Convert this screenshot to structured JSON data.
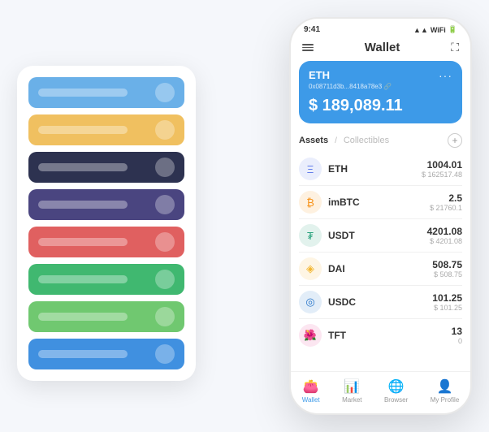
{
  "scene": {
    "background_color": "#f5f7fb"
  },
  "card_stack": {
    "cards": [
      {
        "color": "#6ab0e8",
        "label": ""
      },
      {
        "color": "#f0c060",
        "label": ""
      },
      {
        "color": "#2d3250",
        "label": ""
      },
      {
        "color": "#4a4580",
        "label": ""
      },
      {
        "color": "#e06060",
        "label": ""
      },
      {
        "color": "#40b870",
        "label": ""
      },
      {
        "color": "#70c870",
        "label": ""
      },
      {
        "color": "#4090e0",
        "label": ""
      }
    ]
  },
  "phone": {
    "status_bar": {
      "time": "9:41",
      "icons": "▲▲ ◀"
    },
    "header": {
      "title": "Wallet",
      "menu_icon": "☰",
      "expand_icon": "⛶"
    },
    "eth_card": {
      "title": "ETH",
      "address": "0x08711d3b...8418a78e3 🔗",
      "balance": "$ 189,089.11",
      "menu": "..."
    },
    "tabs": {
      "active": "Assets",
      "slash": "/",
      "inactive": "Collectibles"
    },
    "assets": [
      {
        "name": "ETH",
        "amount": "1004.01",
        "usd": "$ 162517.48",
        "icon_color": "#627eea",
        "icon_symbol": "Ξ"
      },
      {
        "name": "imBTC",
        "amount": "2.5",
        "usd": "$ 21760.1",
        "icon_color": "#f7931a",
        "icon_symbol": "₿"
      },
      {
        "name": "USDT",
        "amount": "4201.08",
        "usd": "$ 4201.08",
        "icon_color": "#26a17b",
        "icon_symbol": "₮"
      },
      {
        "name": "DAI",
        "amount": "508.75",
        "usd": "$ 508.75",
        "icon_color": "#f4b731",
        "icon_symbol": "◈"
      },
      {
        "name": "USDC",
        "amount": "101.25",
        "usd": "$ 101.25",
        "icon_color": "#2775ca",
        "icon_symbol": "◎"
      },
      {
        "name": "TFT",
        "amount": "13",
        "usd": "0",
        "icon_color": "#e84393",
        "icon_symbol": "🌺"
      }
    ],
    "bottom_nav": [
      {
        "label": "Wallet",
        "icon": "👛",
        "active": true
      },
      {
        "label": "Market",
        "icon": "📊",
        "active": false
      },
      {
        "label": "Browser",
        "icon": "🌐",
        "active": false
      },
      {
        "label": "My Profile",
        "icon": "👤",
        "active": false
      }
    ]
  }
}
